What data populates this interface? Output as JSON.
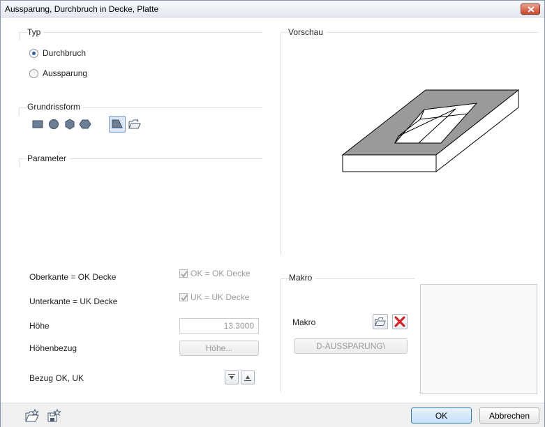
{
  "window": {
    "title": "Aussparung, Durchbruch in Decke, Platte"
  },
  "typ": {
    "group_title": "Typ",
    "options": [
      {
        "label": "Durchbruch",
        "checked": true
      },
      {
        "label": "Aussparung",
        "checked": false
      }
    ]
  },
  "grundriss": {
    "group_title": "Grundrissform",
    "shapes": [
      "rectangle-icon",
      "circle-icon",
      "hexagon-icon",
      "octagon-icon",
      "polygon-icon",
      "open-folder-icon"
    ],
    "selected": "polygon-icon"
  },
  "parameter": {
    "group_title": "Parameter",
    "rows": {
      "oberkante_label": "Oberkante = OK Decke",
      "oberkante_check": "OK = OK Decke",
      "unterkante_label": "Unterkante = UK Decke",
      "unterkante_check": "UK = UK Decke",
      "hoehe_label": "Höhe",
      "hoehe_value": "13.3000",
      "hoehenbezug_label": "Höhenbezug",
      "hoehenbezug_button": "Höhe...",
      "bezug_label": "Bezug OK, UK"
    }
  },
  "vorschau": {
    "group_title": "Vorschau"
  },
  "makro": {
    "group_title": "Makro",
    "label": "Makro",
    "path_button": "D-AUSSPARUNG\\"
  },
  "footer": {
    "ok_label": "OK",
    "cancel_label": "Abbrechen"
  },
  "colors": {
    "accent": "#3c7fb1",
    "close": "#c7432a",
    "preview_fill": "#9a9a9a"
  }
}
